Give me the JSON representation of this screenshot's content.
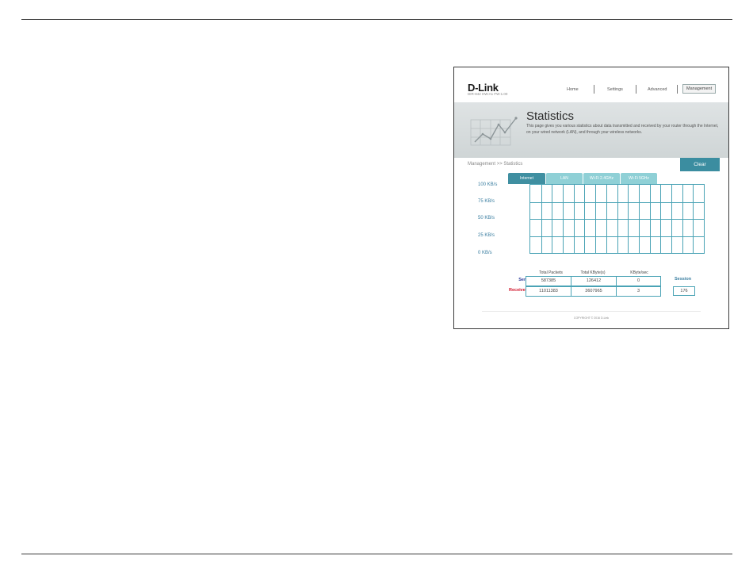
{
  "header": {
    "logo": "D-Link",
    "model": "DIR-842   HW:A1   FW:1.00"
  },
  "nav": {
    "items": [
      {
        "label": "Home"
      },
      {
        "label": "Settings"
      },
      {
        "label": "Advanced"
      },
      {
        "label": "Management"
      }
    ],
    "active": "Management"
  },
  "banner": {
    "title": "Statistics",
    "description": "This page gives you various statistics about data transmitted and received by your router through the Internet, on your wired network (LAN), and through your wireless networks."
  },
  "breadcrumb": "Management >> Statistics",
  "clear_label": "Clear",
  "tabs": [
    {
      "label": "Internet"
    },
    {
      "label": "LAN"
    },
    {
      "label": "Wi-Fi 2.4GHz"
    },
    {
      "label": "Wi-Fi 5GHz"
    }
  ],
  "active_tab": "Internet",
  "chart": {
    "y_labels": [
      "100 KB/s",
      "75 KB/s",
      "50 KB/s",
      "25 KB/s",
      "0 KB/s"
    ]
  },
  "stats": {
    "headers": [
      "Total Packets",
      "Total KByte(s)",
      "KByte/sec"
    ],
    "sent": {
      "label": "Sent:",
      "values": [
        "587385",
        "126412",
        "0"
      ]
    },
    "received": {
      "label": "Received:",
      "values": [
        "11011383",
        "3607965",
        "3"
      ]
    },
    "session_label": "Session",
    "session_value": "176"
  },
  "colors": {
    "accent": "#3b8da0",
    "tab_inactive": "#8fd0d6",
    "sent_label": "#2a3a9a",
    "received_label": "#d0142a"
  },
  "footer": {
    "copyright": "COPYRIGHT © 2016 D-Link"
  }
}
